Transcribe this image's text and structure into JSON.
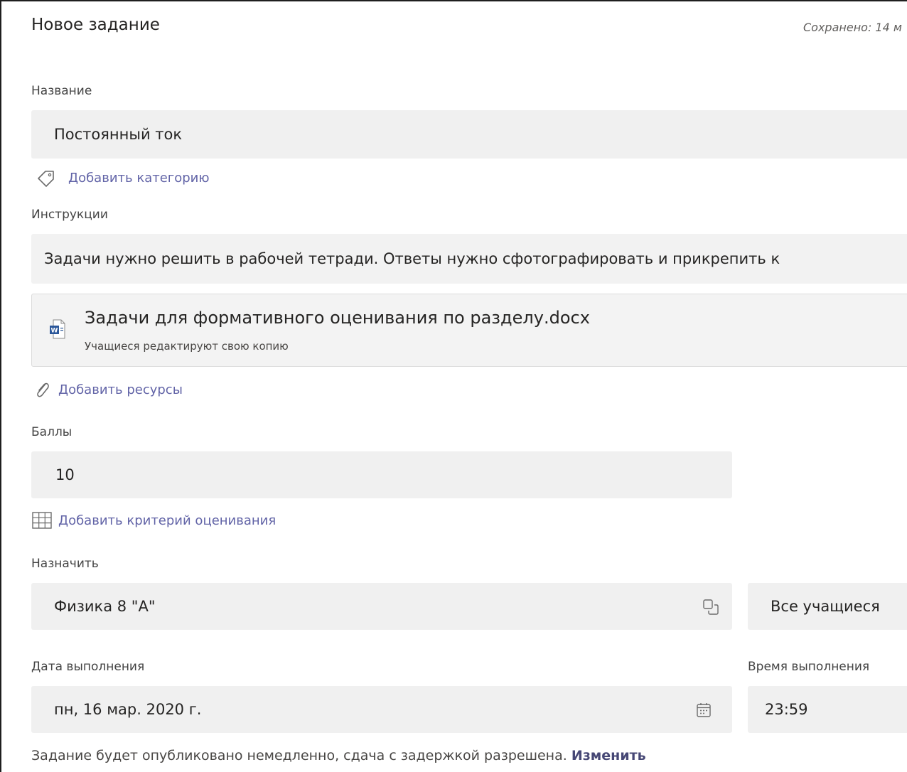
{
  "header": {
    "title": "Новое задание",
    "saved_status": "Сохранено: 14 м"
  },
  "name_section": {
    "label": "Название",
    "value": "Постоянный ток",
    "add_category": "Добавить категорию"
  },
  "instructions_section": {
    "label": "Инструкции",
    "value": "Задачи нужно решить в рабочей тетради. Ответы нужно сфотографировать и прикрепить к"
  },
  "attachment": {
    "file_name": "Задачи для формативного оценивания по разделу.docx",
    "permission": "Учащиеся редактируют свою копию",
    "add_resources": "Добавить ресурсы"
  },
  "points_section": {
    "label": "Баллы",
    "value": "10",
    "add_rubric": "Добавить критерий оценивания"
  },
  "assign_section": {
    "label": "Назначить",
    "class_value": "Физика 8 \"А\"",
    "students_value": "Все учащиеся"
  },
  "due_section": {
    "date_label": "Дата выполнения",
    "date_value": "пн, 16 мар. 2020 г.",
    "time_label": "Время выполнения",
    "time_value": "23:59"
  },
  "footer": {
    "text": "Задание будет опубликовано немедленно, сдача с задержкой разрешена.",
    "change_link": "Изменить"
  },
  "icons": {
    "tag": "tag-icon",
    "paperclip": "paperclip-icon",
    "grid": "grid-icon",
    "copy": "copy-icon",
    "calendar": "calendar-icon",
    "word_file": "word-file-icon"
  },
  "colors": {
    "accent": "#6264a7",
    "field_bg": "#f0f0f0",
    "word_blue": "#2b579a"
  }
}
